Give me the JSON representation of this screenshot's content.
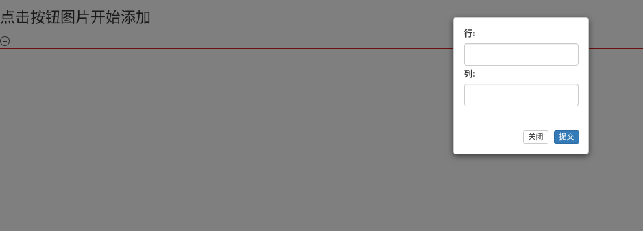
{
  "page": {
    "title": "点击按钮图片开始添加",
    "add_icon": "plus-circle-icon",
    "divider_color": "#d42020"
  },
  "modal": {
    "row_label": "行:",
    "row_value": "",
    "col_label": "列:",
    "col_value": "",
    "close_label": "关闭",
    "submit_label": "提交",
    "submit_color": "#337ab7"
  }
}
